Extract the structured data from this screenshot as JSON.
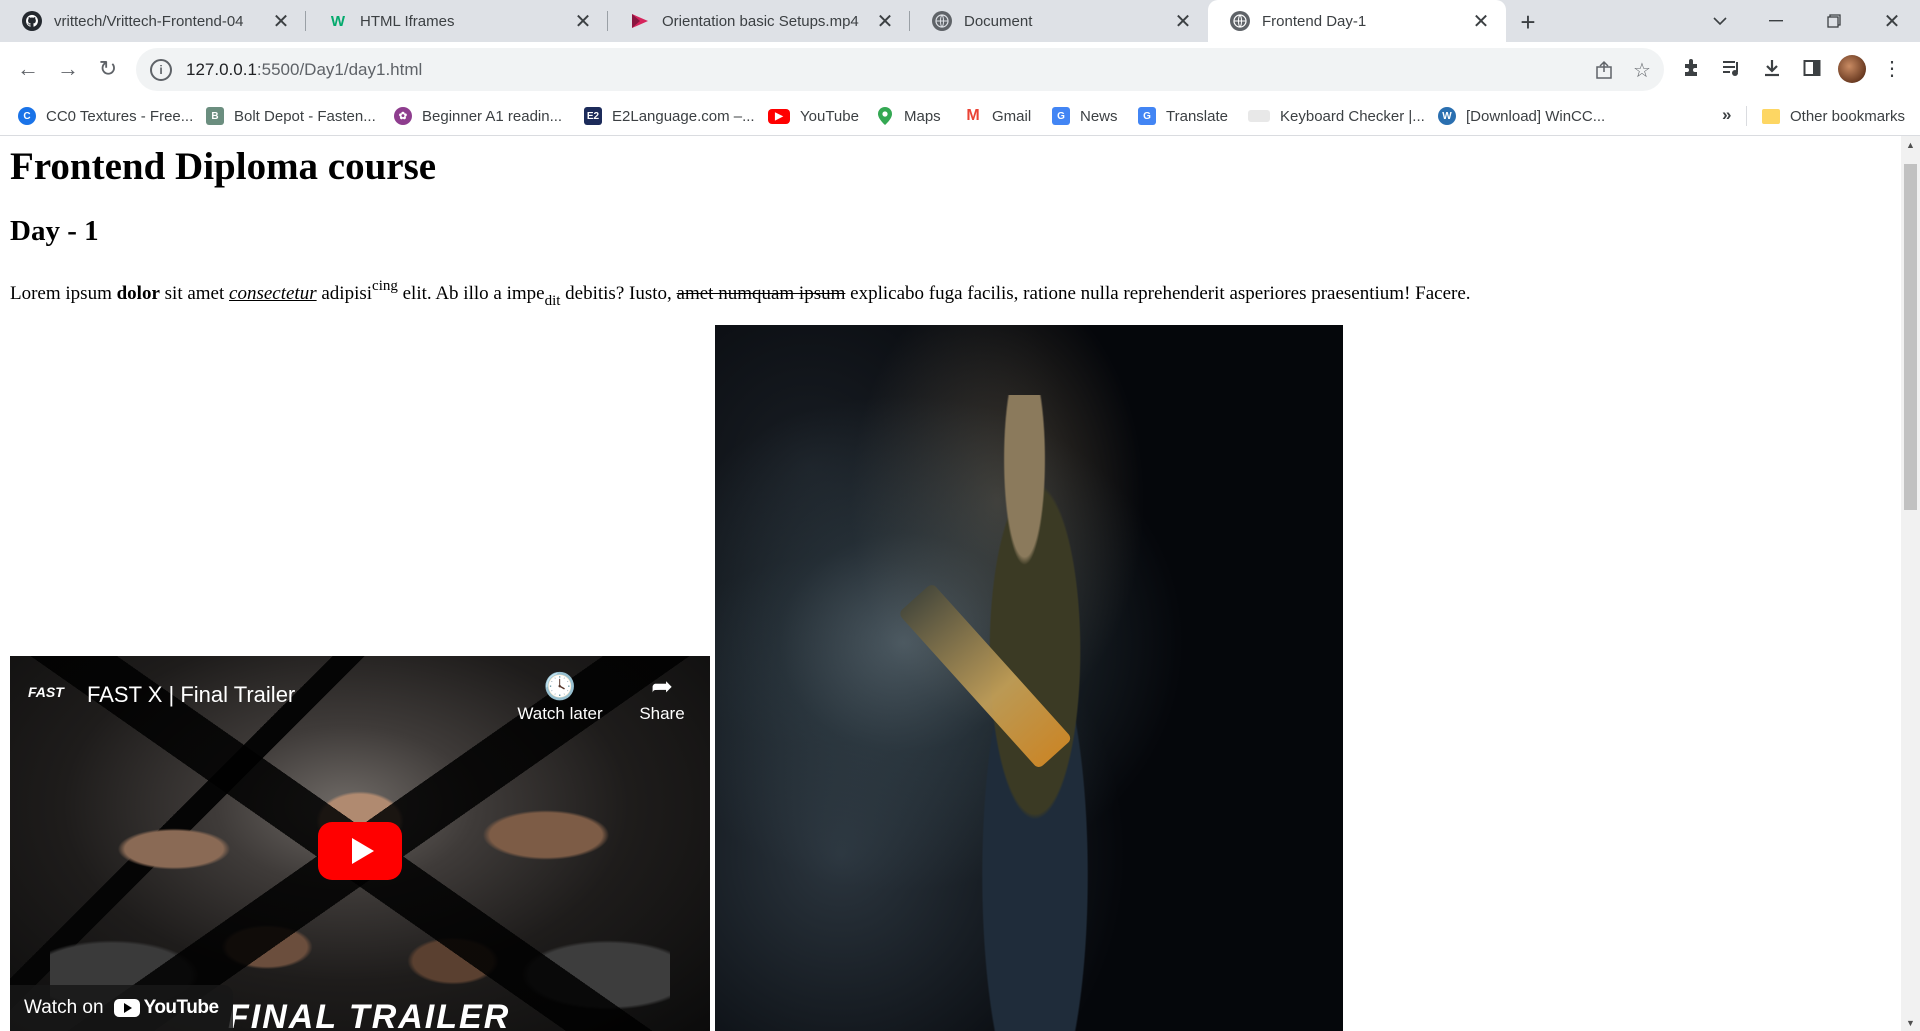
{
  "tabs": [
    {
      "title": "vrittech/Vrittech-Frontend-04",
      "favicon": "github-icon",
      "active": false
    },
    {
      "title": "HTML Iframes",
      "favicon": "w3schools-icon",
      "active": false
    },
    {
      "title": "Orientation basic Setups.mp4",
      "favicon": "video-file-icon",
      "active": false
    },
    {
      "title": "Document",
      "favicon": "globe-icon",
      "active": false
    },
    {
      "title": "Frontend Day-1",
      "favicon": "globe-icon",
      "active": true
    }
  ],
  "address": {
    "host": "127.0.0.1",
    "path": ":5500/Day1/day1.html"
  },
  "bookmarks": [
    {
      "label": "CC0 Textures - Free...",
      "icon": "cc0-icon",
      "color": "#1a73e8"
    },
    {
      "label": "Bolt Depot - Fasten...",
      "icon": "bolt-icon",
      "color": "#6b8e7f"
    },
    {
      "label": "Beginner A1 readin...",
      "icon": "flower-icon",
      "color": "#8e3d8e"
    },
    {
      "label": "E2Language.com –...",
      "icon": "e2-icon",
      "color": "#1c2b5a"
    },
    {
      "label": "YouTube",
      "icon": "youtube-icon",
      "color": "#ff0000"
    },
    {
      "label": "Maps",
      "icon": "maps-icon",
      "color": "#34a853"
    },
    {
      "label": "Gmail",
      "icon": "gmail-icon",
      "color": "#ea4335"
    },
    {
      "label": "News",
      "icon": "news-icon",
      "color": "#4285f4"
    },
    {
      "label": "Translate",
      "icon": "translate-icon",
      "color": "#4285f4"
    },
    {
      "label": "Keyboard Checker |...",
      "icon": "keyboard-icon",
      "color": "#c0c0c0"
    },
    {
      "label": "[Download] WinCC...",
      "icon": "download-site-icon",
      "color": "#2a6fb0"
    }
  ],
  "bookmarks_more": "»",
  "other_bookmarks": "Other bookmarks",
  "page": {
    "h1": "Frontend Diploma course",
    "h2": "Day - 1",
    "para": {
      "t1": "Lorem ipsum ",
      "bold": "dolor",
      "t2": " sit amet ",
      "em_u": "consectetur",
      "t3": " adipisi",
      "sup": "cing",
      "t4": " elit. Ab illo a impe",
      "sub": "dit",
      "t5": " debitis? Iusto, ",
      "strike": "amet numquam ipsum",
      "t6": " explicabo fuga facilis, ratione nulla reprehenderit asperiores praesentium! Facere."
    },
    "video": {
      "logo": "FAST",
      "title": "FAST X | Final Trailer",
      "watch_later": "Watch later",
      "share": "Share",
      "watch_on": "Watch on",
      "youtube": "YouTube",
      "overlay_text": "FINAL TRAILER"
    }
  }
}
